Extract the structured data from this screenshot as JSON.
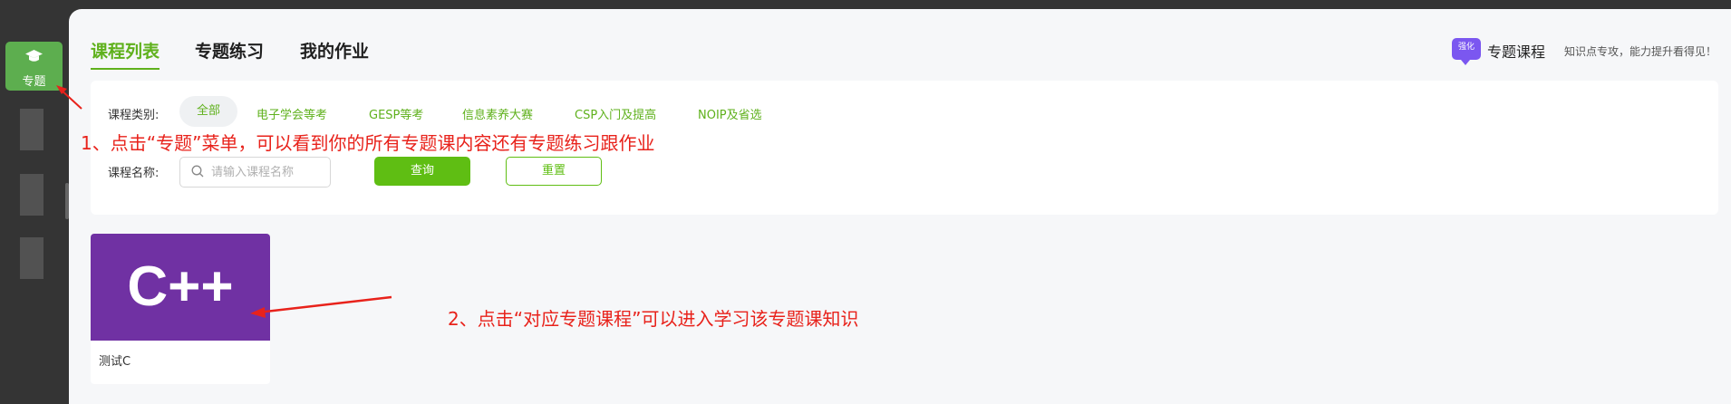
{
  "sidebar": {
    "active_item": {
      "label": "专题",
      "icon": "graduation-cap-icon"
    },
    "accent_color": "#5dae4f"
  },
  "tabs": [
    {
      "label": "课程列表",
      "active": true
    },
    {
      "label": "专题练习",
      "active": false
    },
    {
      "label": "我的作业",
      "active": false
    }
  ],
  "brand": {
    "badge": "强化",
    "title": "专题课程",
    "slogan": "知识点专攻，能力提升看得见！"
  },
  "filters": {
    "category_label": "课程类别:",
    "categories": [
      {
        "label": "全部",
        "active": true
      },
      {
        "label": "电子学会等考",
        "active": false
      },
      {
        "label": "GESP等考",
        "active": false
      },
      {
        "label": "信息素养大赛",
        "active": false
      },
      {
        "label": "CSP入门及提高",
        "active": false
      },
      {
        "label": "NOIP及省选",
        "active": false
      }
    ],
    "name_label": "课程名称:",
    "search_placeholder": "请输入课程名称",
    "search_value": "",
    "query_button": "查询",
    "reset_button": "重置"
  },
  "courses": [
    {
      "cover_text": "C++",
      "name": "测试C",
      "cover_color": "#7031a3"
    }
  ],
  "annotations": [
    "1、点击“专题”菜单，可以看到你的所有专题课内容还有专题练习跟作业",
    "2、点击“对应专题课程”可以进入学习该专题课知识"
  ],
  "colors": {
    "brand_green": "#5fb11c",
    "annotation_red": "#e8221b",
    "brand_purple": "#7b57f0"
  }
}
